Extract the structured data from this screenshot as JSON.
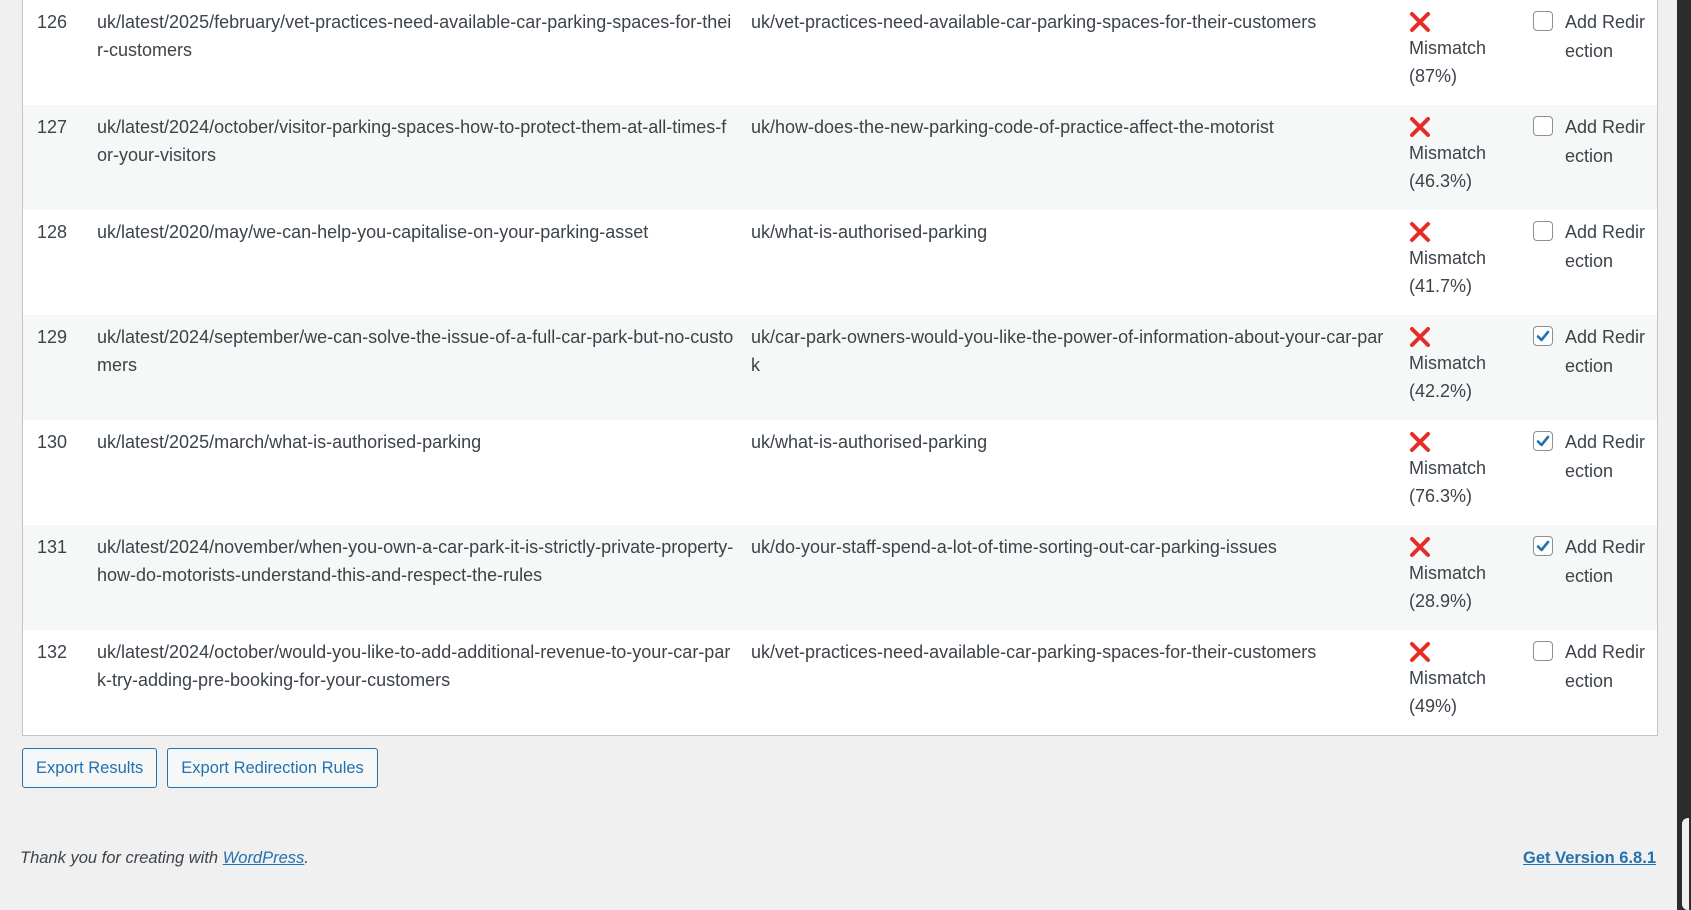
{
  "rows": [
    {
      "num": "126",
      "source": "uk/latest/2025/february/vet-practices-need-available-car-parking-spaces-for-their-customers",
      "target": "uk/vet-practices-need-available-car-parking-spaces-for-their-customers",
      "status": "Mismatch",
      "score": "(87%)",
      "checked": false,
      "action_label": "Add Redirection"
    },
    {
      "num": "127",
      "source": "uk/latest/2024/october/visitor-parking-spaces-how-to-protect-them-at-all-times-for-your-visitors",
      "target": "uk/how-does-the-new-parking-code-of-practice-affect-the-motorist",
      "status": "Mismatch",
      "score": "(46.3%)",
      "checked": false,
      "action_label": "Add Redirection"
    },
    {
      "num": "128",
      "source": "uk/latest/2020/may/we-can-help-you-capitalise-on-your-parking-asset",
      "target": "uk/what-is-authorised-parking",
      "status": "Mismatch",
      "score": "(41.7%)",
      "checked": false,
      "action_label": "Add Redirection"
    },
    {
      "num": "129",
      "source": "uk/latest/2024/september/we-can-solve-the-issue-of-a-full-car-park-but-no-customers",
      "target": "uk/car-park-owners-would-you-like-the-power-of-information-about-your-car-park",
      "status": "Mismatch",
      "score": "(42.2%)",
      "checked": true,
      "action_label": "Add Redirection"
    },
    {
      "num": "130",
      "source": "uk/latest/2025/march/what-is-authorised-parking",
      "target": "uk/what-is-authorised-parking",
      "status": "Mismatch",
      "score": "(76.3%)",
      "checked": true,
      "action_label": "Add Redirection"
    },
    {
      "num": "131",
      "source": "uk/latest/2024/november/when-you-own-a-car-park-it-is-strictly-private-property-how-do-motorists-understand-this-and-respect-the-rules",
      "target": "uk/do-your-staff-spend-a-lot-of-time-sorting-out-car-parking-issues",
      "status": "Mismatch",
      "score": "(28.9%)",
      "checked": true,
      "action_label": "Add Redirection"
    },
    {
      "num": "132",
      "source": "uk/latest/2024/october/would-you-like-to-add-additional-revenue-to-your-car-park-try-adding-pre-booking-for-your-customers",
      "target": "uk/vet-practices-need-available-car-parking-spaces-for-their-customers",
      "status": "Mismatch",
      "score": "(49%)",
      "checked": false,
      "action_label": "Add Redirection"
    }
  ],
  "buttons": {
    "export_results": "Export Results",
    "export_rules": "Export Redirection Rules"
  },
  "footer": {
    "thanks_prefix": "Thank you for creating with ",
    "wordpress_link": "WordPress",
    "thanks_suffix": ".",
    "version_link": "Get Version 6.8.1"
  },
  "colors": {
    "mismatch_icon": "#e52d27",
    "link": "#2271b1",
    "checkbox_check": "#2271b1"
  },
  "icons": {
    "status": "cross-mark-icon",
    "checkbox_checked": "checkmark-icon"
  }
}
